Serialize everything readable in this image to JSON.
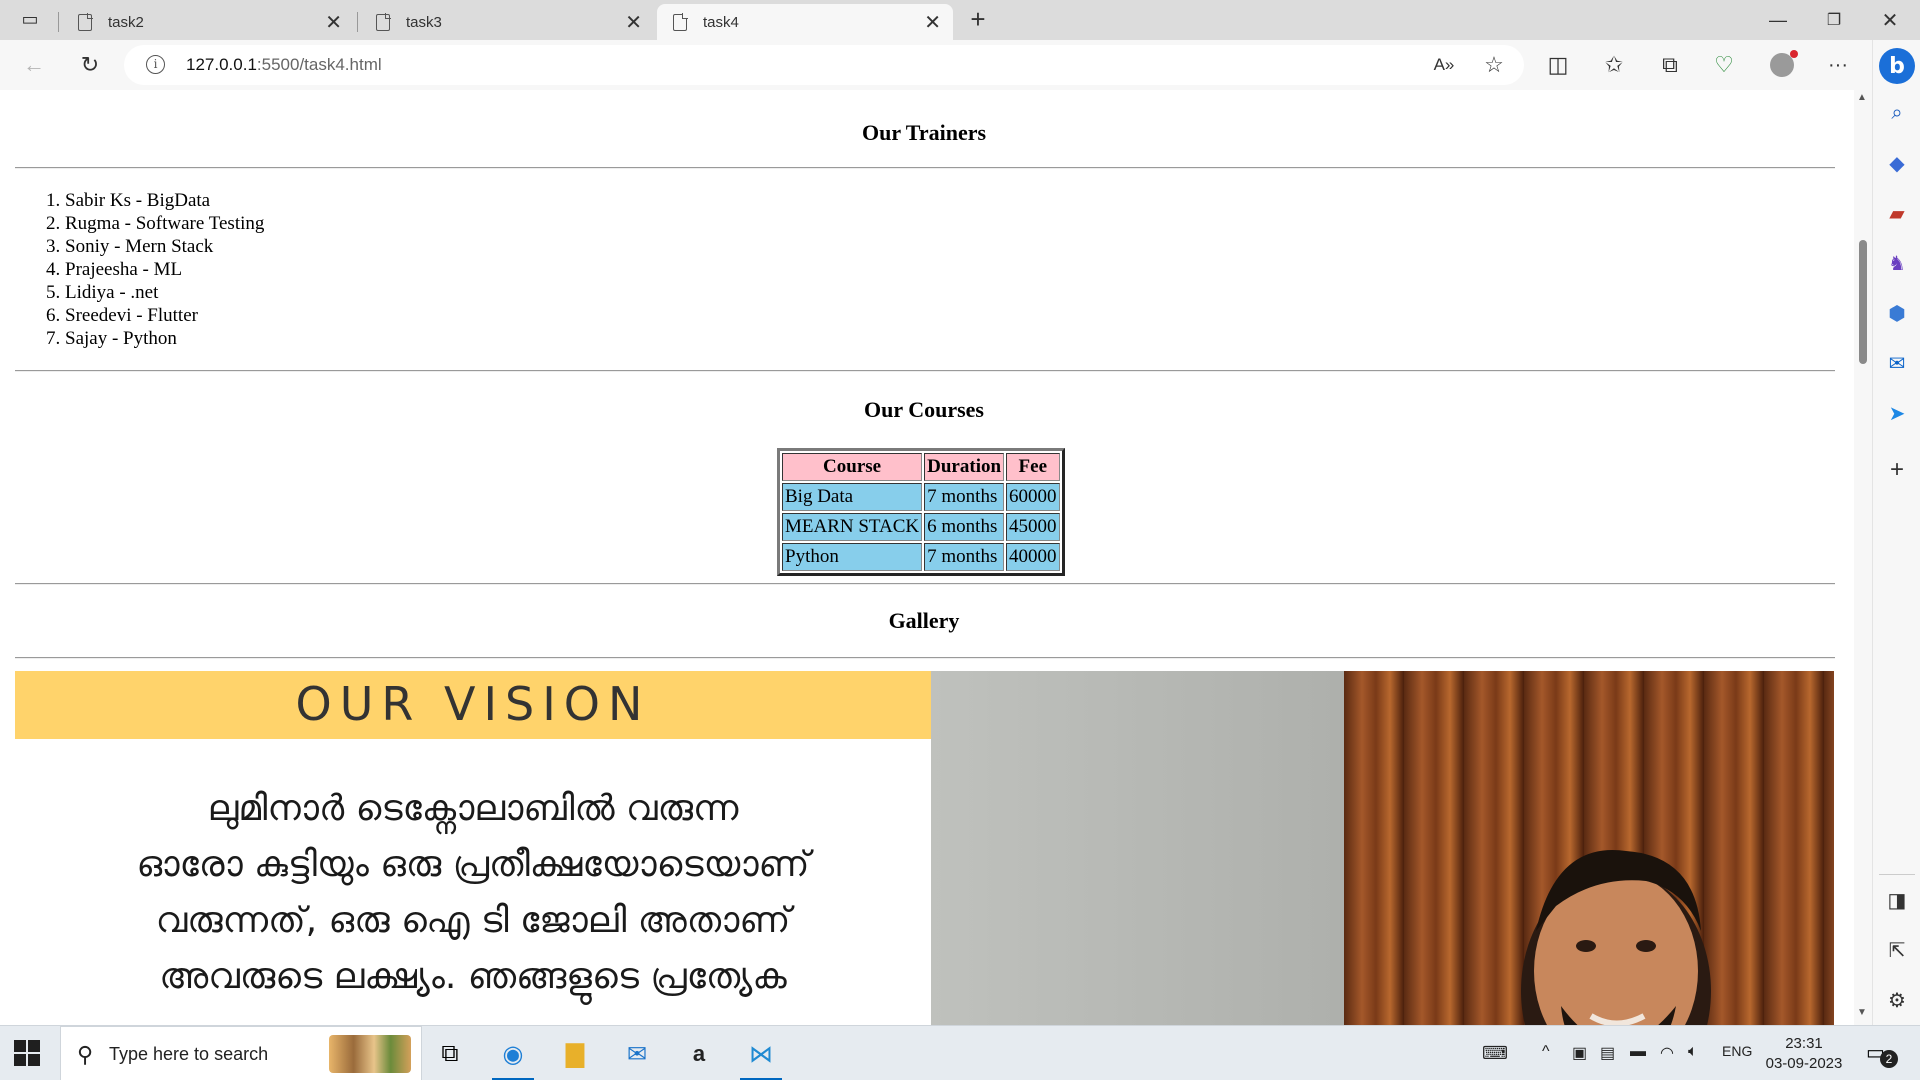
{
  "browser": {
    "tabs": [
      {
        "title": "task2"
      },
      {
        "title": "task3"
      },
      {
        "title": "task4",
        "active": true
      }
    ],
    "new_tab_symbol": "+",
    "address": {
      "host": "127.0.0.1",
      "path": ":5500/task4.html"
    }
  },
  "page": {
    "trainers_heading": "Our Trainers",
    "trainers": [
      "Sabir Ks - BigData",
      "Rugma - Software Testing",
      "Soniy - Mern Stack",
      "Prajeesha - ML",
      "Lidiya - .net",
      "Sreedevi - Flutter",
      "Sajay - Python"
    ],
    "courses_heading": "Our Courses",
    "courses_table": {
      "headers": [
        "Course",
        "Duration",
        "Fee"
      ],
      "rows": [
        [
          "Big Data",
          "7 months",
          "60000"
        ],
        [
          "MEARN STACK",
          "6 months",
          "45000"
        ],
        [
          "Python",
          "7 months",
          "40000"
        ]
      ],
      "header_color": "#ffc0cb",
      "cell_color": "#87ceeb"
    },
    "gallery_heading": "Gallery",
    "vision_image": {
      "banner": "OUR VISION",
      "lines": [
        "ലുമിനാർ ടെക്നോലാബിൽ വരുന്ന",
        "ഓരോ കുട്ടിയും ഒരു പ്രതീക്ഷയോടെയാണ്",
        "വരുന്നത്, ഒരു ഐ ടി ജോലി അതാണ്",
        "അവരുടെ ലക്ഷ്യം. ഞങ്ങളുടെ പ്രത്യേക"
      ]
    }
  },
  "taskbar": {
    "search_placeholder": "Type here to search",
    "language": "ENG",
    "time": "23:31",
    "date": "03-09-2023",
    "notification_count": "2"
  }
}
